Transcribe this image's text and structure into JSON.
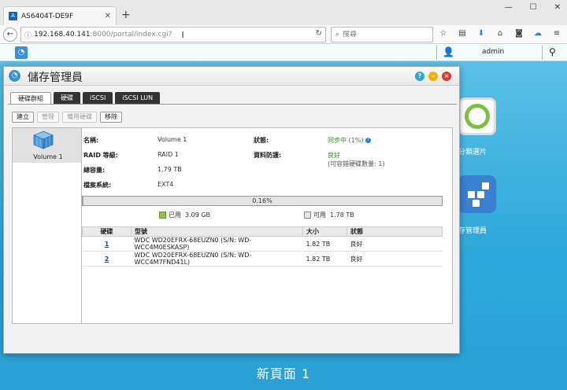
{
  "browser": {
    "tab_title": "AS6404T-DE9F",
    "tab_close": "✕",
    "new_tab": "+",
    "window_controls": [
      "—",
      "☐",
      "✕"
    ],
    "url_host": "192.168.40.141",
    "url_rest": ":8000/portal/index.cgi?",
    "search_placeholder": "搜尋",
    "icons": [
      "bookmark-star-icon",
      "reader-icon",
      "download-icon",
      "home-icon",
      "pocket-icon",
      "sync-icon",
      "menu-icon"
    ]
  },
  "taskbar": {
    "user": "admin"
  },
  "desktop": {
    "icon_a_label": "分類選片",
    "icon_b_label": "存管理員",
    "page_label": "新頁面 1"
  },
  "window": {
    "title": "儲存管理員",
    "tabs": [
      "硬碟群組",
      "硬碟",
      "iSCSI",
      "iSCSI LUN"
    ],
    "toolbar": {
      "create": "建立",
      "manage": "管理",
      "hot_spare": "備用硬碟",
      "remove": "移除"
    },
    "volume_name": "Volume 1",
    "details": {
      "name_label": "名稱:",
      "name_value": "Volume 1",
      "raid_label": "RAID 等級:",
      "raid_value": "RAID 1",
      "capacity_label": "總容量:",
      "capacity_value": "1.79 TB",
      "fs_label": "檔案系統:",
      "fs_value": "EXT4",
      "status_label": "狀態:",
      "status_value": "同步中 (1%)",
      "protection_label": "資料防護:",
      "protection_value": "良好",
      "protection_note": "(可容錯硬碟數量: 1)"
    },
    "usage": {
      "percent_text": "0.16%",
      "used_fraction": 0.0016,
      "used_label": "已用",
      "used_value": "3.09 GB",
      "free_label": "可用",
      "free_value": "1.78 TB"
    },
    "disk_table": {
      "headers": [
        "硬碟",
        "型號",
        "大小",
        "狀態"
      ],
      "rows": [
        {
          "disk": "1",
          "model": "WDC WD20EFRX-68EUZN0 (S/N: WD-WCC4M0ESKASP)",
          "size": "1.82 TB",
          "status": "良好"
        },
        {
          "disk": "2",
          "model": "WDC WD20EFRX-68EUZN0 (S/N: WD-WCC4M7FND41L)",
          "size": "1.82 TB",
          "status": "良好"
        }
      ]
    }
  },
  "colors": {
    "desktop_top": "#5ec2e8",
    "desktop_bottom": "#2aa0d4",
    "used_green": "#8ac63f",
    "status_green": "#2e8b22"
  }
}
